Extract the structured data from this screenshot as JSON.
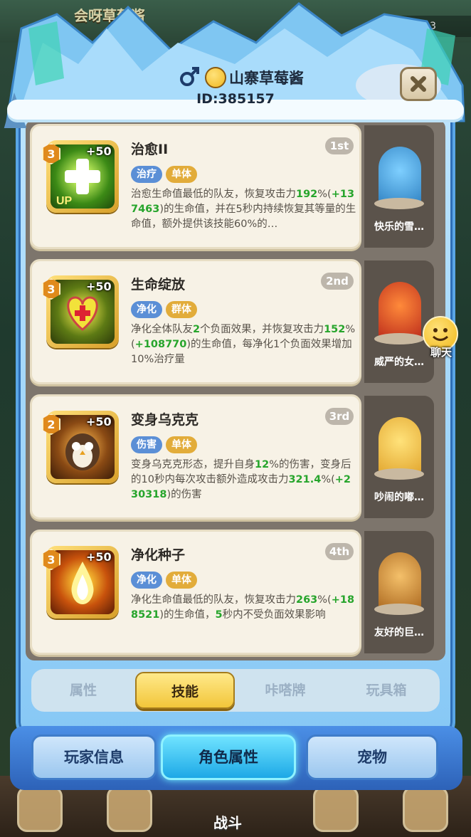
{
  "background": {
    "topbar_name": "会呀草莓酱",
    "topbar_value": "1187.3",
    "battle_label": "战斗"
  },
  "header": {
    "player_name": "山寨草莓酱",
    "player_id": "ID:385157"
  },
  "skills": [
    {
      "name": "治愈II",
      "rank": "1st",
      "level": "3",
      "bonus": "+50",
      "up_label": "UP",
      "tags": [
        "治疗",
        "单体"
      ],
      "desc_parts": [
        "治愈生命值最低的队友，恢复攻击力",
        "192",
        "%(",
        "+137463",
        ")的生命值，并在5秒内持续恢复其等量的生命值，额外提供该技能60%的…"
      ],
      "pet_name": "快乐的雪…"
    },
    {
      "name": "生命绽放",
      "rank": "2nd",
      "level": "3",
      "bonus": "+50",
      "tags": [
        "净化",
        "群体"
      ],
      "desc_parts": [
        "净化全体队友",
        "2",
        "个负面效果，并恢复攻击力",
        "152",
        "%(",
        "+108770",
        ")的生命值，每净化1个负面效果增加10%治疗量"
      ],
      "pet_name": "威严的女…"
    },
    {
      "name": "变身乌克克",
      "rank": "3rd",
      "level": "2",
      "bonus": "+50",
      "tags": [
        "伤害",
        "单体"
      ],
      "desc_parts": [
        "变身乌克克形态，提升自身",
        "12",
        "%的伤害，变身后的10秒内每次攻击额外造成攻击力",
        "321.4",
        "%(",
        "+230318",
        ")的伤害"
      ],
      "pet_name": "吵闹的嘟…"
    },
    {
      "name": "净化种子",
      "rank": "4th",
      "level": "3",
      "bonus": "+50",
      "tags": [
        "净化",
        "单体"
      ],
      "desc_parts": [
        "净化生命值最低的队友，恢复攻击力",
        "263",
        "%(",
        "+188521",
        ")的生命值，",
        "5",
        "秒内不受负面效果影响"
      ],
      "pet_name": "友好的巨…"
    }
  ],
  "chat": {
    "label": "聊天"
  },
  "subtabs": [
    "属性",
    "技能",
    "咔嗒牌",
    "玩具箱"
  ],
  "subtab_active": "技能",
  "maintabs": [
    "玩家信息",
    "角色属性",
    "宠物"
  ],
  "maintab_active": "角色属性",
  "colors": {
    "highlight_green": "#27a52c",
    "tag_blue": "#5b8fd6",
    "tag_gold": "#e2ac3a",
    "active_tab_gold": "#f2c63a",
    "active_tab_cyan": "#1da8e6"
  }
}
